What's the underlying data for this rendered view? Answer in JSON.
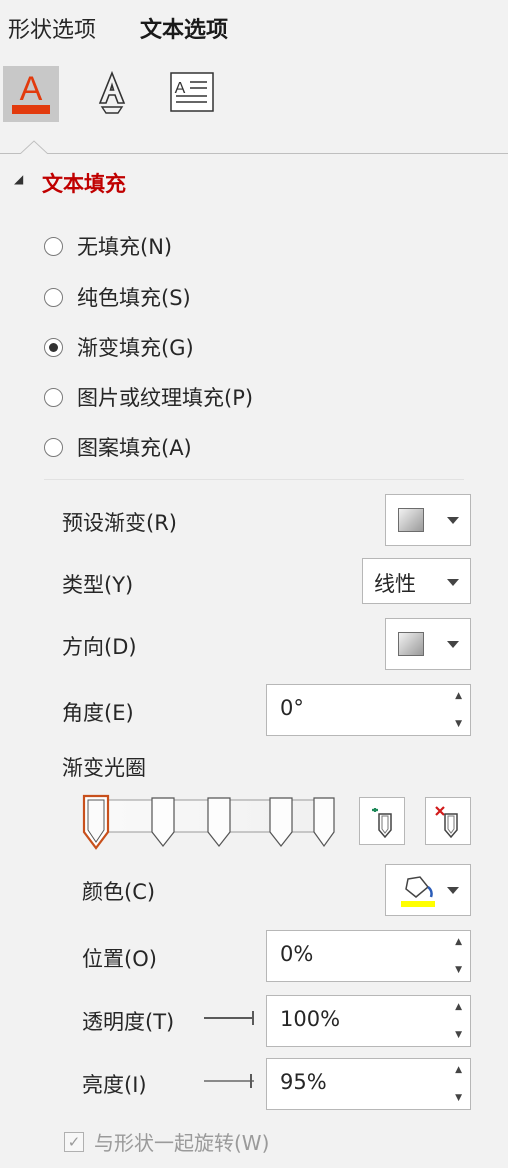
{
  "tabs": {
    "shape": "形状选项",
    "text": "文本选项"
  },
  "icons": {
    "text_fill": "text-fill-outline-icon",
    "text_effects": "text-effects-icon",
    "text_box": "text-box-icon"
  },
  "section": {
    "title": "文本填充"
  },
  "fill_options": [
    {
      "label": "无填充(N)",
      "checked": false
    },
    {
      "label": "纯色填充(S)",
      "checked": false
    },
    {
      "label": "渐变填充(G)",
      "checked": true
    },
    {
      "label": "图片或纹理填充(P)",
      "checked": false
    },
    {
      "label": "图案填充(A)",
      "checked": false
    }
  ],
  "gradient": {
    "preset_label": "预设渐变(R)",
    "type_label": "类型(Y)",
    "type_value": "线性",
    "direction_label": "方向(D)",
    "angle_label": "角度(E)",
    "angle_value": "0°",
    "stops_label": "渐变光圈",
    "color_label": "颜色(C)",
    "position_label": "位置(O)",
    "position_value": "0%",
    "transparency_label": "透明度(T)",
    "transparency_value": "100%",
    "brightness_label": "亮度(I)",
    "brightness_value": "95%"
  },
  "rotate_with_shape": {
    "label": "与形状一起旋转(W)",
    "checked": true
  },
  "colors": {
    "accent": "#c00000",
    "fill_bar": "#e23a0d",
    "highlight": "#ffff00"
  }
}
